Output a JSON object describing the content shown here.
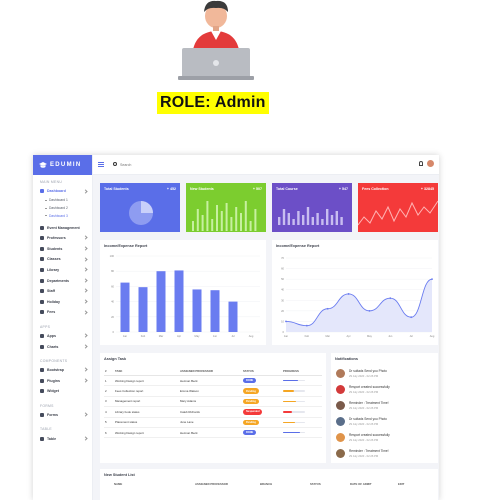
{
  "hero": {
    "role_label": "ROLE: Admin",
    "icon": "admin-user-laptop-icon"
  },
  "app": {
    "brand": "EDUMIN",
    "search_placeholder": "Search",
    "accent": "#5a6ee8"
  },
  "sidebar": {
    "main_title": "MAIN MENU",
    "dashboard": "Dashboard",
    "dashboard_sub": [
      "Dashboard 1",
      "Dashboard 2",
      "Dashboard 3"
    ],
    "items": [
      "Event Management",
      "Professors",
      "Students",
      "Classes",
      "Library",
      "Departments",
      "Staff",
      "Holiday",
      "Fees"
    ],
    "apps_title": "APPS",
    "apps_items": [
      "Apps",
      "Charts"
    ],
    "components_title": "COMPONENTS",
    "components_items": [
      "Bootstrap",
      "Plugins",
      "Widget"
    ],
    "forms_title": "FORMS",
    "forms_items": [
      "Forms"
    ],
    "table_title": "TABLE",
    "table_items": [
      "Table"
    ]
  },
  "stats": [
    {
      "label": "Total Students",
      "value": "+ 452",
      "color": "#5a6ee8"
    },
    {
      "label": "New Students",
      "value": "+ 507",
      "color": "#7ccd2f"
    },
    {
      "label": "Total Course",
      "value": "+ 547",
      "color": "#6c4fc7"
    },
    {
      "label": "Fees Collection",
      "value": "+ 32845",
      "color": "#f43a3a"
    }
  ],
  "income_bar": {
    "title": "Income/Expense Report"
  },
  "income_line": {
    "title": "Income/Expense Report"
  },
  "chart_data": [
    {
      "type": "bar",
      "title": "Income/Expense Report",
      "categories": [
        "Jan",
        "Feb",
        "Mar",
        "Apr",
        "May",
        "Jun",
        "Jul",
        "Aug"
      ],
      "values": [
        65,
        59,
        80,
        81,
        56,
        55,
        40,
        0
      ],
      "ylim": [
        0,
        100
      ],
      "yticks": [
        0,
        20,
        40,
        60,
        80,
        100
      ],
      "grid": true
    },
    {
      "type": "area",
      "title": "Income/Expense Report",
      "categories": [
        "Jan",
        "Feb",
        "Mar",
        "Apr",
        "May",
        "Jun",
        "Jul",
        "Aug"
      ],
      "values": [
        10,
        6,
        22,
        36,
        20,
        32,
        14,
        50
      ],
      "ylim": [
        0,
        70
      ],
      "yticks": [
        0,
        10,
        20,
        30,
        40,
        50,
        60,
        70
      ],
      "grid": true
    }
  ],
  "tasks": {
    "title": "Assign Task",
    "headers": [
      "#",
      "TASK",
      "ASSIGNED PROFESSOR",
      "STATUS",
      "PROGRESS"
    ],
    "rows": [
      {
        "no": "1",
        "task": "Working Design report",
        "prof": "Herman Beck",
        "status": "DONE",
        "status_color": "#5a6ee8",
        "progress": 0.7,
        "bar_color": "#5a6ee8"
      },
      {
        "no": "2",
        "task": "Fees Collection report",
        "prof": "Emma Watson",
        "status": "Pending",
        "status_color": "#f5a623",
        "progress": 0.5,
        "bar_color": "#f5a623"
      },
      {
        "no": "3",
        "task": "Management report",
        "prof": "Mary Adams",
        "status": "Pending",
        "status_color": "#f5a623",
        "progress": 0.6,
        "bar_color": "#f5a623"
      },
      {
        "no": "4",
        "task": "Library book status",
        "prof": "Caleb Richards",
        "status": "Suspended",
        "status_color": "#f43a3a",
        "progress": 0.4,
        "bar_color": "#f43a3a"
      },
      {
        "no": "5",
        "task": "Placement status",
        "prof": "June Lane",
        "status": "Pending",
        "status_color": "#f5a623",
        "progress": 0.55,
        "bar_color": "#f5a623"
      },
      {
        "no": "6",
        "task": "Working Design report",
        "prof": "Herman Beck",
        "status": "DONE",
        "status_color": "#5a6ee8",
        "progress": 0.75,
        "bar_color": "#5a6ee8"
      }
    ]
  },
  "notifications": {
    "title": "Notifications",
    "items": [
      {
        "title": "Dr sultads Send you Photo",
        "date": "29 July 2020 - 02:26 PM",
        "color": "#b07a5a"
      },
      {
        "title": "Resport created successfully",
        "date": "29 July 2020 - 02:26 PM",
        "color": "#d33a3a"
      },
      {
        "title": "Reminder : Treatment Time!",
        "date": "29 July 2020 - 02:26 PM",
        "color": "#7a5a4a"
      },
      {
        "title": "Dr sultads Send you Photo",
        "date": "29 July 2020 - 02:26 PM",
        "color": "#5a6e8a"
      },
      {
        "title": "Resport created successfully",
        "date": "29 July 2020 - 02:26 PM",
        "color": "#e0944a"
      },
      {
        "title": "Reminder : Treatment Time!",
        "date": "29 July 2020 - 02:26 PM",
        "color": "#8a6a4a"
      }
    ]
  },
  "student_list": {
    "title": "New Student List",
    "headers": [
      "NAME",
      "ASSIGNED PROFESSOR",
      "BRANCH",
      "STATUS",
      "DATE OF ADMIT",
      "EDIT"
    ]
  }
}
